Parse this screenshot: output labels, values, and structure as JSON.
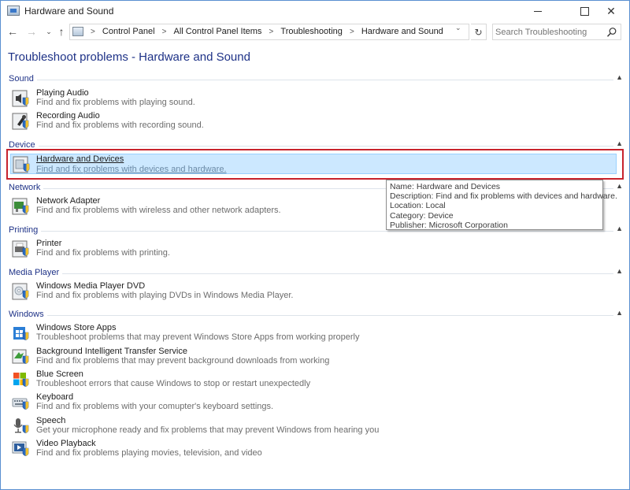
{
  "window": {
    "title": "Hardware and Sound",
    "controls": {
      "minimize": "—",
      "maximize": "□",
      "close": "✕"
    }
  },
  "nav": {
    "back": "←",
    "forward": "→",
    "recent": "⌄",
    "up": "↑",
    "breadcrumbs": [
      "Control Panel",
      "All Control Panel Items",
      "Troubleshooting",
      "Hardware and Sound"
    ],
    "separator": ">",
    "dropdown": "⌄",
    "refresh": "↻",
    "search_placeholder": "Search Troubleshooting"
  },
  "page_title": "Troubleshoot problems - Hardware and Sound",
  "groups": [
    {
      "header": "Sound",
      "items": [
        {
          "name": "Playing Audio",
          "desc": "Find and fix problems with playing sound.",
          "icon": "speaker-icon"
        },
        {
          "name": "Recording Audio",
          "desc": "Find and fix problems with recording sound.",
          "icon": "microphone-icon"
        }
      ]
    },
    {
      "header": "Device",
      "items": [
        {
          "name": "Hardware and Devices",
          "desc": "Find and fix problems with devices and hardware.",
          "icon": "device-icon",
          "selected": true
        }
      ]
    },
    {
      "header": "Network",
      "items": [
        {
          "name": "Network Adapter",
          "desc": "Find and fix problems with wireless and other network adapters.",
          "icon": "network-adapter-icon"
        }
      ]
    },
    {
      "header": "Printing",
      "items": [
        {
          "name": "Printer",
          "desc": "Find and fix problems with printing.",
          "icon": "printer-icon"
        }
      ]
    },
    {
      "header": "Media Player",
      "items": [
        {
          "name": "Windows Media Player DVD",
          "desc": "Find and fix problems with playing DVDs in Windows Media Player.",
          "icon": "dvd-icon"
        }
      ]
    },
    {
      "header": "Windows",
      "items": [
        {
          "name": "Windows Store Apps",
          "desc": "Troubleshoot problems that may prevent Windows Store Apps from working properly",
          "icon": "store-icon"
        },
        {
          "name": "Background Intelligent Transfer Service",
          "desc": "Find and fix problems that may prevent background downloads from working",
          "icon": "transfer-icon"
        },
        {
          "name": "Blue Screen",
          "desc": "Troubleshoot errors that cause Windows to stop or restart unexpectedly",
          "icon": "windows-logo-icon"
        },
        {
          "name": "Keyboard",
          "desc": "Find and fix problems with your comupter's keyboard settings.",
          "icon": "keyboard-icon"
        },
        {
          "name": "Speech",
          "desc": "Get your microphone ready and fix problems that may prevent Windows from hearing you",
          "icon": "speech-microphone-icon"
        },
        {
          "name": "Video Playback",
          "desc": "Find and fix problems playing movies, television, and video",
          "icon": "video-icon"
        }
      ]
    }
  ],
  "tooltip": {
    "name": "Name: Hardware and Devices",
    "description": "Description: Find and fix problems with devices and hardware.",
    "location": "Location: Local",
    "category": "Category: Device",
    "publisher": "Publisher: Microsoft Corporation"
  },
  "colors": {
    "heading": "#1e3287",
    "selection": "#cce8ff",
    "highlight_border": "#c8232c"
  }
}
